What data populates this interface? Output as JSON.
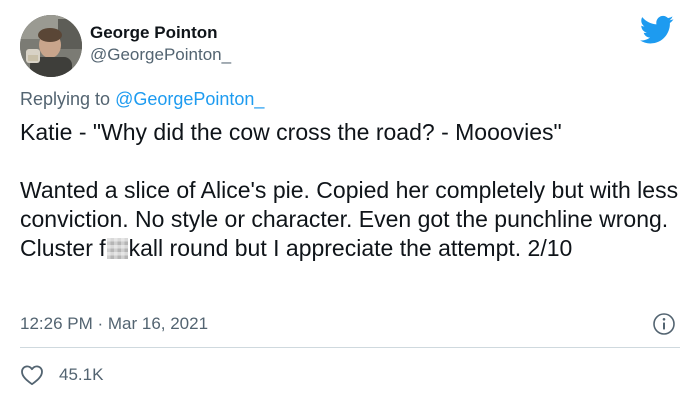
{
  "author": {
    "display_name": "George Pointon",
    "handle": "@GeorgePointon_"
  },
  "reply": {
    "prefix": "Replying to ",
    "mention": "@GeorgePointon_"
  },
  "tweet": {
    "text_part1": "Katie - \"Why did the cow cross the road? - Mooovies\"\n\nWanted a slice of Alice's pie. Copied her completely but with less conviction. No style or character. Even got the punchline wrong. Cluster f",
    "text_part2": "kall round but I appreciate the attempt. 2/10"
  },
  "meta": {
    "timestamp": "12:26 PM · Mar 16, 2021"
  },
  "stats": {
    "likes": "45.1K"
  },
  "icons": {
    "brand": "twitter-bird-icon",
    "info": "info-icon",
    "like": "heart-icon"
  },
  "colors": {
    "brand_blue": "#1d9bf0",
    "text_primary": "#0f1419",
    "text_secondary": "#536471",
    "divider": "#cfd9de"
  }
}
